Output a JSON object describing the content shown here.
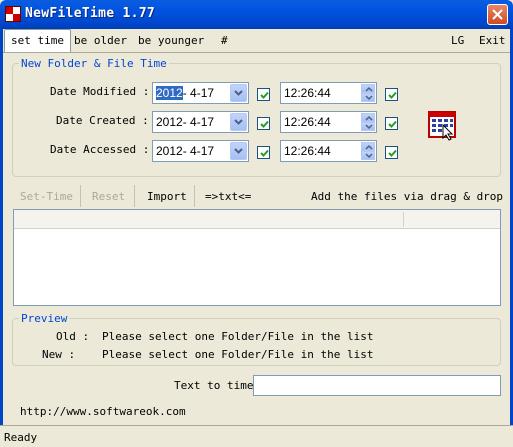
{
  "window": {
    "title": "NewFileTime 1.77",
    "close_icon": "close-icon"
  },
  "menu": {
    "tabs": [
      "set time",
      "be older",
      "be younger",
      "#"
    ],
    "right": [
      "LG",
      "Exit"
    ]
  },
  "group1": {
    "title": "New Folder & File Time",
    "rows": [
      {
        "label": "Date Modified :",
        "date_year": "2012",
        "date_rest": "- 4-17",
        "date_checked": true,
        "time": "12:26:44",
        "time_checked": true
      },
      {
        "label": "Date Created :",
        "date_year": "2012",
        "date_rest": "- 4-17",
        "date_checked": true,
        "time": "12:26:44",
        "time_checked": true
      },
      {
        "label": "Date Accessed :",
        "date_year": "2012",
        "date_rest": "- 4-17",
        "date_checked": true,
        "time": "12:26:44",
        "time_checked": true
      }
    ]
  },
  "toolbar": {
    "set_time": "Set-Time",
    "reset": "Reset",
    "import": "Import",
    "txt": "=>txt<=",
    "drag_drop": "Add the files via drag & drop",
    "drag_drop_arrow": "▾"
  },
  "preview": {
    "title": "Preview",
    "old_label": "Old :",
    "old_value": "Please select one Folder/File in the list",
    "new_label": "New :",
    "new_value": "Please select one Folder/File in the list"
  },
  "text_to_time": {
    "label": "Text to time",
    "value": ""
  },
  "url": "http://www.softwareok.com",
  "status": "Ready",
  "colors": {
    "titlebar": "#0054e3",
    "group_title": "#0046d5",
    "face": "#ece9d8",
    "selection": "#316ac5"
  }
}
